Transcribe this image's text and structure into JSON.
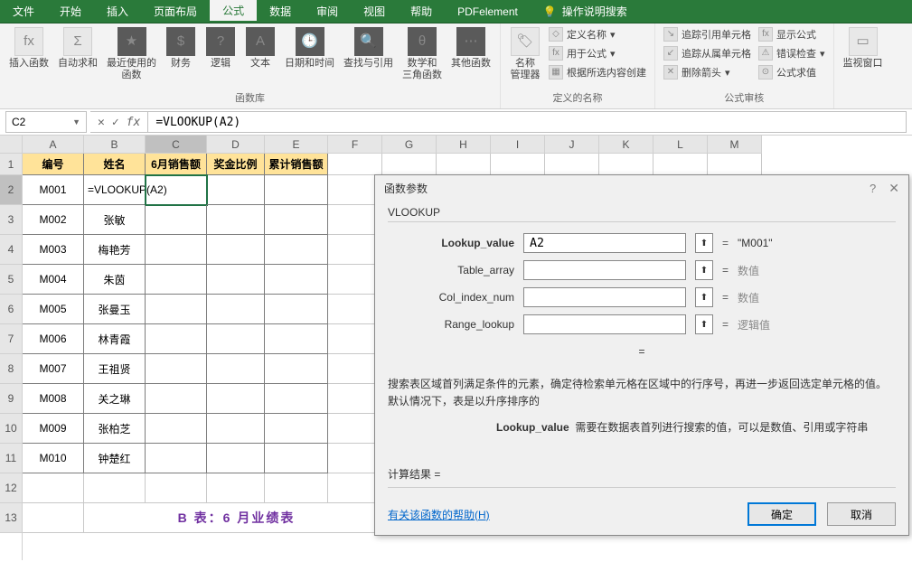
{
  "tabs": {
    "file": "文件",
    "home": "开始",
    "insert": "插入",
    "layout": "页面布局",
    "formula": "公式",
    "data": "数据",
    "review": "审阅",
    "view": "视图",
    "help": "帮助",
    "pdf": "PDFelement",
    "tell": "操作说明搜索"
  },
  "ribbon": {
    "group1": "函数库",
    "group2": "定义的名称",
    "group3": "公式审核",
    "btns": {
      "insertfn": "插入函数",
      "autosum": "自动求和",
      "recent": "最近使用的\n函数",
      "financial": "财务",
      "logical": "逻辑",
      "text": "文本",
      "datetime": "日期和时间",
      "lookup": "查找与引用",
      "math": "数学和\n三角函数",
      "more": "其他函数",
      "namem": "名称\n管理器",
      "watch": "监视窗口"
    },
    "lines": {
      "define": "定义名称",
      "usein": "用于公式",
      "fromsel": "根据所选内容创建",
      "traceP": "追踪引用单元格",
      "traceD": "追踪从属单元格",
      "remove": "删除箭头",
      "showf": "显示公式",
      "errchk": "错误检查",
      "eval": "公式求值"
    }
  },
  "formulabar": {
    "cellref": "C2",
    "formula": "=VLOOKUP(A2)"
  },
  "columns": [
    "A",
    "B",
    "C",
    "D",
    "E",
    "F",
    "G",
    "H",
    "I",
    "J",
    "K",
    "L",
    "M"
  ],
  "headers": {
    "a": "编号",
    "b": "姓名",
    "c": "6月销售额",
    "d": "奖金比例",
    "e": "累计销售额"
  },
  "rows": [
    {
      "id": "M001",
      "name": "=VLOOKUP(A2)"
    },
    {
      "id": "M002",
      "name": "张敏"
    },
    {
      "id": "M003",
      "name": "梅艳芳"
    },
    {
      "id": "M004",
      "name": "朱茵"
    },
    {
      "id": "M005",
      "name": "张曼玉"
    },
    {
      "id": "M006",
      "name": "林青霞"
    },
    {
      "id": "M007",
      "name": "王祖贤"
    },
    {
      "id": "M008",
      "name": "关之琳"
    },
    {
      "id": "M009",
      "name": "张柏芝"
    },
    {
      "id": "M010",
      "name": "钟楚红"
    }
  ],
  "mergedTitle": "B 表：6 月业绩表",
  "dialog": {
    "title": "函数参数",
    "fn": "VLOOKUP",
    "args": {
      "lookup_value": {
        "label": "Lookup_value",
        "value": "A2",
        "result": "\"M001\"",
        "bold": true
      },
      "table_array": {
        "label": "Table_array",
        "value": "",
        "result": "数值"
      },
      "col_index": {
        "label": "Col_index_num",
        "value": "",
        "result": "数值"
      },
      "range": {
        "label": "Range_lookup",
        "value": "",
        "result": "逻辑值"
      }
    },
    "eq": "=",
    "desc": "搜索表区域首列满足条件的元素，确定待检索单元格在区域中的行序号，再进一步返回选定单元格的值。默认情况下，表是以升序排序的",
    "subdesc_label": "Lookup_value",
    "subdesc_text": "需要在数据表首列进行搜索的值，可以是数值、引用或字符串",
    "result_label": "计算结果 =",
    "result_value": "",
    "help_link": "有关该函数的帮助(H)",
    "ok": "确定",
    "cancel": "取消"
  }
}
